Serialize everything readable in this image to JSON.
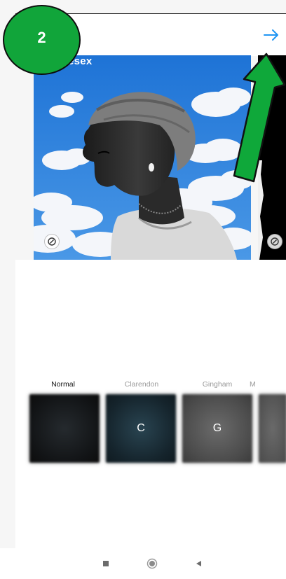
{
  "step_badge": {
    "number": "2"
  },
  "header": {
    "next_icon": "arrow-right-icon",
    "accent_color": "#2196f3"
  },
  "carousel": {
    "watermark_text": "esex",
    "items": [
      {
        "name": "photo-woman-clouds",
        "badge_icon": "multi-photo-icon"
      },
      {
        "name": "photo-black",
        "badge_icon": "multi-photo-icon"
      }
    ]
  },
  "filters": [
    {
      "label": "Normal",
      "letter": "",
      "selected": true
    },
    {
      "label": "Clarendon",
      "letter": "C",
      "selected": false
    },
    {
      "label": "Gingham",
      "letter": "G",
      "selected": false
    },
    {
      "label": "M",
      "letter": "",
      "selected": false
    }
  ],
  "annotation": {
    "arrow_color": "#0fa83a",
    "badge_color": "#11a53a"
  },
  "navbar": {
    "buttons": [
      "recent-apps-icon",
      "home-icon",
      "back-icon"
    ]
  }
}
